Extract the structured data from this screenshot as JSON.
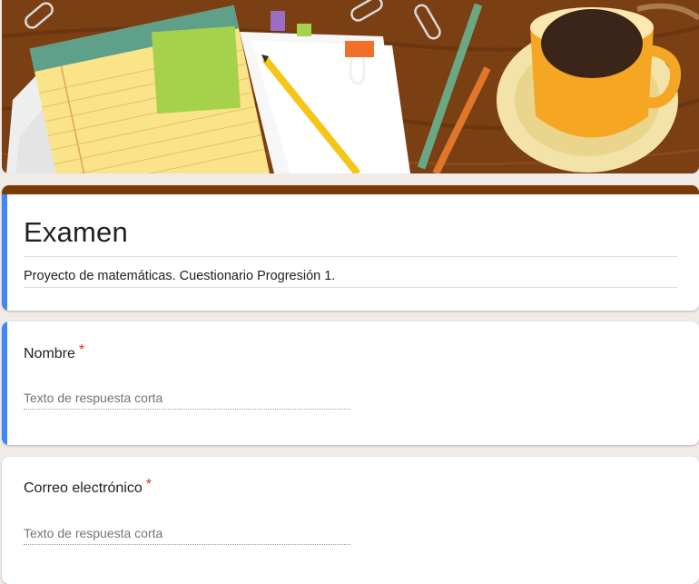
{
  "banner": {
    "theme": "desk-notepad-coffee-header"
  },
  "colors": {
    "page_background": "#f1ebe8",
    "theme_bar": "#7b3b06",
    "active_indicator": "#4285f4",
    "required_asterisk": "#d93025"
  },
  "form": {
    "title": "Examen",
    "description": "Proyecto de matemáticas. Cuestionario Progresión 1."
  },
  "questions": [
    {
      "label": "Nombre",
      "required_mark": "*",
      "placeholder": "Texto de respuesta corta",
      "active": true
    },
    {
      "label": "Correo electrónico",
      "required_mark": "*",
      "placeholder": "Texto de respuesta corta",
      "active": false
    }
  ]
}
